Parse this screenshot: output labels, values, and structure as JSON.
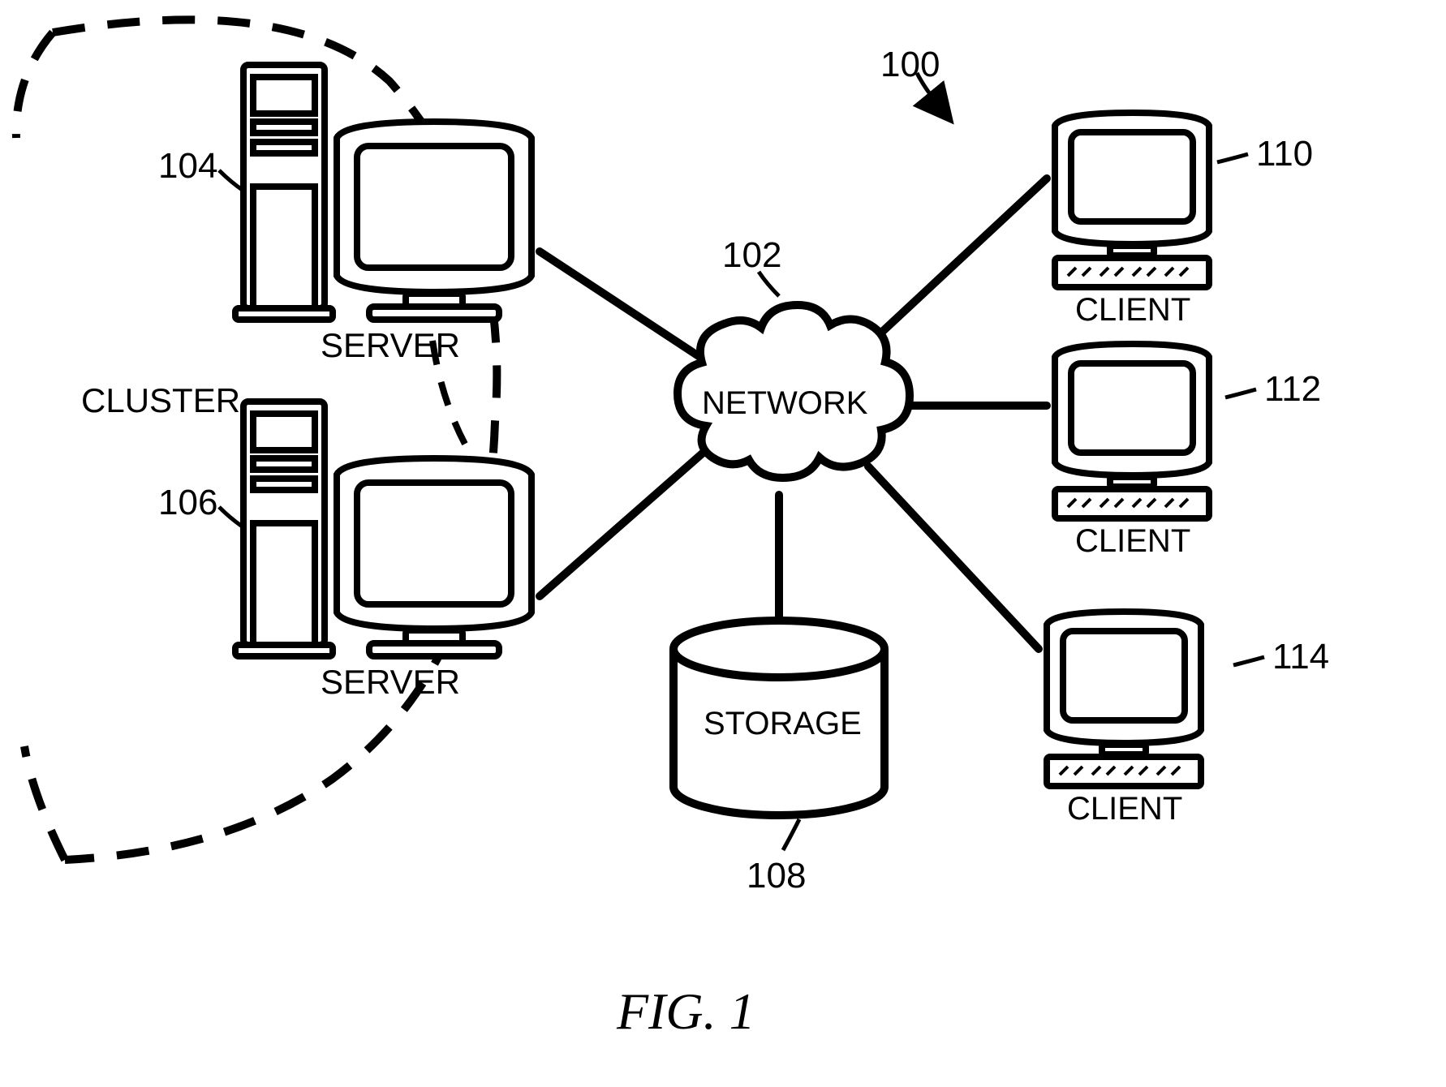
{
  "figure": {
    "caption": "FIG. 1",
    "ref_overall": "100"
  },
  "cluster": {
    "label": "CLUSTER"
  },
  "servers": {
    "top": {
      "label": "SERVER",
      "ref": "104"
    },
    "bottom": {
      "label": "SERVER",
      "ref": "106"
    }
  },
  "network": {
    "label": "NETWORK",
    "ref": "102"
  },
  "storage": {
    "label": "STORAGE",
    "ref": "108"
  },
  "clients": {
    "top": {
      "label": "CLIENT",
      "ref": "110"
    },
    "middle": {
      "label": "CLIENT",
      "ref": "112"
    },
    "bottom": {
      "label": "CLIENT",
      "ref": "114"
    }
  }
}
